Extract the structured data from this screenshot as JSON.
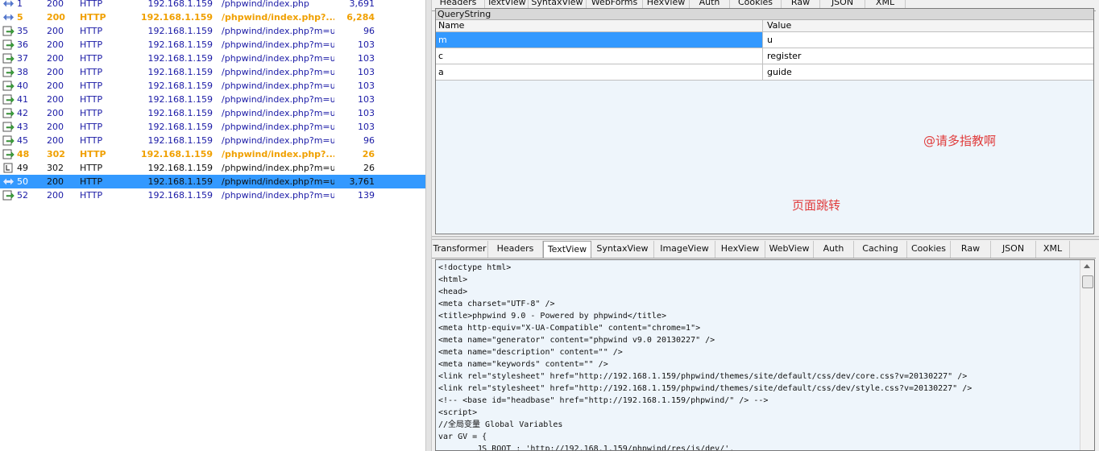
{
  "sessions": [
    {
      "num": "1",
      "result": "200",
      "protocol": "HTTP",
      "host": "192.168.1.159",
      "url": "/phpwind/index.php",
      "body": "3,691",
      "style": "blue",
      "icon": "double-arrow"
    },
    {
      "num": "5",
      "result": "200",
      "protocol": "HTTP",
      "host": "192.168.1.159",
      "url": "/phpwind/index.php?...",
      "body": "6,284",
      "style": "orange",
      "icon": "double-arrow"
    },
    {
      "num": "35",
      "result": "200",
      "protocol": "HTTP",
      "host": "192.168.1.159",
      "url": "/phpwind/index.php?m=u...",
      "body": "96",
      "style": "blue",
      "icon": "response"
    },
    {
      "num": "36",
      "result": "200",
      "protocol": "HTTP",
      "host": "192.168.1.159",
      "url": "/phpwind/index.php?m=u...",
      "body": "103",
      "style": "blue",
      "icon": "response"
    },
    {
      "num": "37",
      "result": "200",
      "protocol": "HTTP",
      "host": "192.168.1.159",
      "url": "/phpwind/index.php?m=u...",
      "body": "103",
      "style": "blue",
      "icon": "response"
    },
    {
      "num": "38",
      "result": "200",
      "protocol": "HTTP",
      "host": "192.168.1.159",
      "url": "/phpwind/index.php?m=u...",
      "body": "103",
      "style": "blue",
      "icon": "response"
    },
    {
      "num": "40",
      "result": "200",
      "protocol": "HTTP",
      "host": "192.168.1.159",
      "url": "/phpwind/index.php?m=u...",
      "body": "103",
      "style": "blue",
      "icon": "response"
    },
    {
      "num": "41",
      "result": "200",
      "protocol": "HTTP",
      "host": "192.168.1.159",
      "url": "/phpwind/index.php?m=u...",
      "body": "103",
      "style": "blue",
      "icon": "response"
    },
    {
      "num": "42",
      "result": "200",
      "protocol": "HTTP",
      "host": "192.168.1.159",
      "url": "/phpwind/index.php?m=u...",
      "body": "103",
      "style": "blue",
      "icon": "response"
    },
    {
      "num": "43",
      "result": "200",
      "protocol": "HTTP",
      "host": "192.168.1.159",
      "url": "/phpwind/index.php?m=u...",
      "body": "103",
      "style": "blue",
      "icon": "response"
    },
    {
      "num": "45",
      "result": "200",
      "protocol": "HTTP",
      "host": "192.168.1.159",
      "url": "/phpwind/index.php?m=u...",
      "body": "96",
      "style": "blue",
      "icon": "response"
    },
    {
      "num": "48",
      "result": "302",
      "protocol": "HTTP",
      "host": "192.168.1.159",
      "url": "/phpwind/index.php?...",
      "body": "26",
      "style": "orange",
      "icon": "response"
    },
    {
      "num": "49",
      "result": "302",
      "protocol": "HTTP",
      "host": "192.168.1.159",
      "url": "/phpwind/index.php?m=u...",
      "body": "26",
      "style": "black",
      "icon": "redirect"
    },
    {
      "num": "50",
      "result": "200",
      "protocol": "HTTP",
      "host": "192.168.1.159",
      "url": "/phpwind/index.php?m=u...",
      "body": "3,761",
      "style": "selected",
      "icon": "double-arrow"
    },
    {
      "num": "52",
      "result": "200",
      "protocol": "HTTP",
      "host": "192.168.1.159",
      "url": "/phpwind/index.php?m=u...",
      "body": "139",
      "style": "blue",
      "icon": "response"
    }
  ],
  "request_tabs": [
    "Headers",
    "TextView",
    "SyntaxView",
    "WebForms",
    "HexView",
    "Auth",
    "Cookies",
    "Raw",
    "JSON",
    "XML"
  ],
  "querystring": {
    "title": "QueryString",
    "col_name": "Name",
    "col_value": "Value",
    "rows": [
      {
        "name": "m",
        "value": "u"
      },
      {
        "name": "c",
        "value": "register"
      },
      {
        "name": "a",
        "value": "guide"
      }
    ]
  },
  "annotations": {
    "comment": "@请多指教啊",
    "redirect_note": "页面跳转"
  },
  "response_tabs": [
    "Transformer",
    "Headers",
    "TextView",
    "SyntaxView",
    "ImageView",
    "HexView",
    "WebView",
    "Auth",
    "Caching",
    "Cookies",
    "Raw",
    "JSON",
    "XML"
  ],
  "response_active_tab": "TextView",
  "textview_lines": [
    "<!doctype html>",
    "<html>",
    "<head>",
    "<meta charset=\"UTF-8\" />",
    "<title>phpwind 9.0 - Powered by phpwind</title>",
    "<meta http-equiv=\"X-UA-Compatible\" content=\"chrome=1\">",
    "<meta name=\"generator\" content=\"phpwind v9.0 20130227\" />",
    "<meta name=\"description\" content=\"\" />",
    "<meta name=\"keywords\" content=\"\" />",
    "<link rel=\"stylesheet\" href=\"http://192.168.1.159/phpwind/themes/site/default/css/dev/core.css?v=20130227\" />",
    "<link rel=\"stylesheet\" href=\"http://192.168.1.159/phpwind/themes/site/default/css/dev/style.css?v=20130227\" />",
    "<!-- <base id=\"headbase\" href=\"http://192.168.1.159/phpwind/\" /> -->",
    "<script>",
    "//全局变量 Global Variables",
    "var GV = {",
    "        JS_ROOT : 'http://192.168.1.159/phpwind/res/js/dev/',"
  ],
  "colors": {
    "selection": "#3399ff",
    "row_blue": "#1a1aa6",
    "row_orange": "#f0a000",
    "annotation": "#e03c3c",
    "panel_bg": "#eef5fb"
  }
}
